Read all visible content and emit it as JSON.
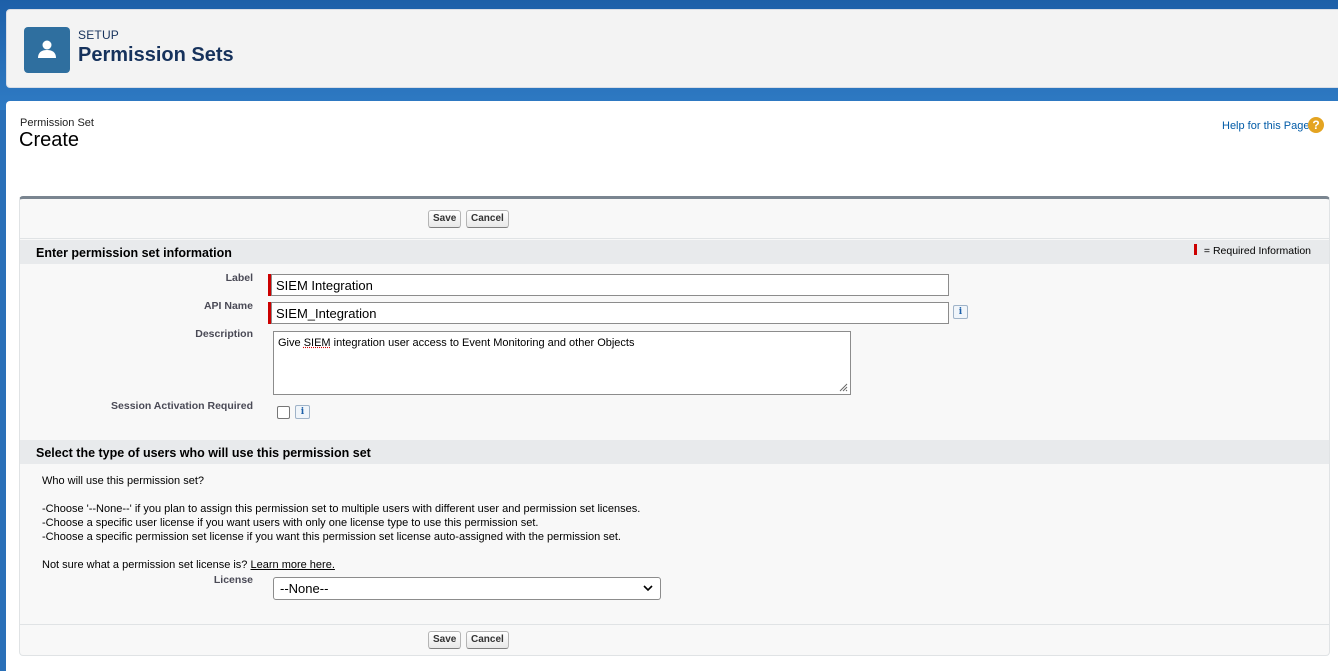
{
  "header": {
    "crumb": "SETUP",
    "title": "Permission Sets"
  },
  "page": {
    "type": "Permission Set",
    "description": "Create",
    "help_link": "Help for this Page",
    "help_icon": "question-icon"
  },
  "buttons": {
    "save": "Save",
    "cancel": "Cancel"
  },
  "section1": {
    "title": "Enter permission set information",
    "required_legend": "= Required Information",
    "fields": {
      "label": {
        "label": "Label",
        "value": "SIEM Integration"
      },
      "api_name": {
        "label": "API Name",
        "value": "SIEM_Integration"
      },
      "description": {
        "label": "Description",
        "value_prefix": "Give ",
        "value_word": "SIEM",
        "value_suffix": " integration user access to Event Monitoring and other Objects"
      },
      "session": {
        "label": "Session Activation Required",
        "checked": false
      }
    },
    "info_glyph": "i"
  },
  "section2": {
    "title": "Select the type of users who will use this permission set",
    "question": "Who will use this permission set?",
    "bullets": [
      "-Choose '--None--' if you plan to assign this permission set to multiple users with different user and permission set licenses.",
      "-Choose a specific user license if you want users with only one license type to use this permission set.",
      "-Choose a specific permission set license if you want this permission set license auto-assigned with the permission set."
    ],
    "not_sure": "Not sure what a permission set license is?",
    "learn_more": "Learn more here.",
    "license_label": "License",
    "license_value": "--None--"
  },
  "colors": {
    "brand_blue": "#1d5fa8",
    "header_icon_bg": "#2f6f9f",
    "required_red": "#cc0000",
    "help_orange": "#e4a421"
  }
}
